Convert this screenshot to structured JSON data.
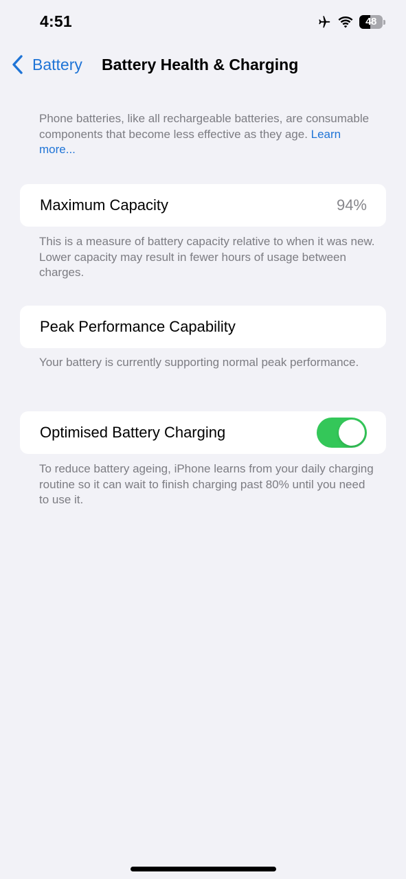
{
  "status_bar": {
    "time": "4:51",
    "icons": [
      "airplane-mode-icon",
      "wifi-icon",
      "battery-icon"
    ],
    "battery_level_text": "48",
    "battery_level_percent": 48
  },
  "nav": {
    "back_label": "Battery",
    "title": "Battery Health & Charging"
  },
  "intro": {
    "text": "Phone batteries, like all rechargeable batteries, are consumable components that become less effective as they age. ",
    "link_label": "Learn more..."
  },
  "sections": [
    {
      "label": "Maximum Capacity",
      "value": "94%",
      "footer": "This is a measure of battery capacity relative to when it was new. Lower capacity may result in fewer hours of usage between charges."
    },
    {
      "label": "Peak Performance Capability",
      "footer": "Your battery is currently supporting normal peak performance."
    },
    {
      "label": "Optimised Battery Charging",
      "toggle_on": true,
      "footer": "To reduce battery ageing, iPhone learns from your daily charging routine so it can wait to finish charging past 80% until you need to use it."
    }
  ],
  "colors": {
    "accent": "#1f74d6",
    "toggle_on": "#34c759",
    "background": "#f2f2f7",
    "secondary_text": "#7c7c82"
  }
}
